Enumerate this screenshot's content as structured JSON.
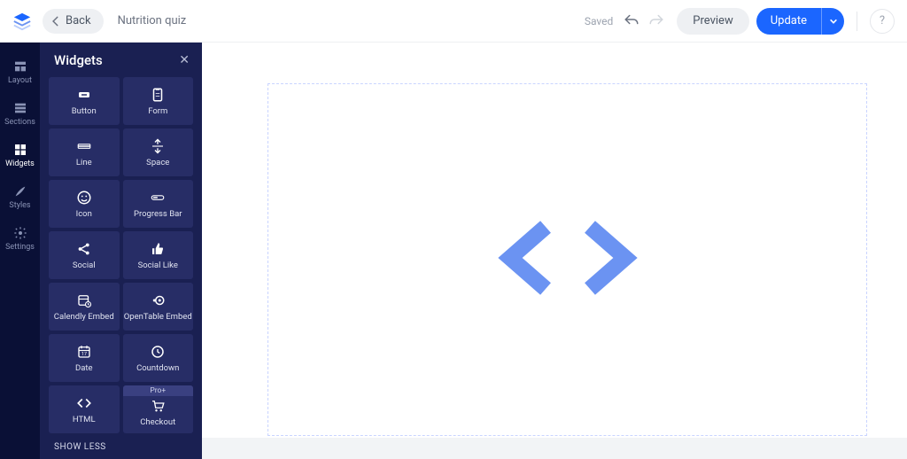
{
  "header": {
    "back_label": "Back",
    "page_title": "Nutrition quiz",
    "saved_label": "Saved",
    "preview_label": "Preview",
    "update_label": "Update",
    "help_label": "?"
  },
  "nav": {
    "items": [
      {
        "label": "Layout"
      },
      {
        "label": "Sections"
      },
      {
        "label": "Widgets"
      },
      {
        "label": "Styles"
      },
      {
        "label": "Settings"
      }
    ],
    "active_index": 2
  },
  "panel": {
    "title": "Widgets",
    "show_less": "SHOW LESS",
    "pro_badge": "Pro+",
    "tiles": [
      {
        "label": "Button"
      },
      {
        "label": "Form"
      },
      {
        "label": "Line"
      },
      {
        "label": "Space"
      },
      {
        "label": "Icon"
      },
      {
        "label": "Progress Bar"
      },
      {
        "label": "Social"
      },
      {
        "label": "Social Like"
      },
      {
        "label": "Calendly Embed"
      },
      {
        "label": "OpenTable Embed"
      },
      {
        "label": "Date"
      },
      {
        "label": "Countdown"
      },
      {
        "label": "HTML"
      },
      {
        "label": "Checkout"
      }
    ]
  }
}
